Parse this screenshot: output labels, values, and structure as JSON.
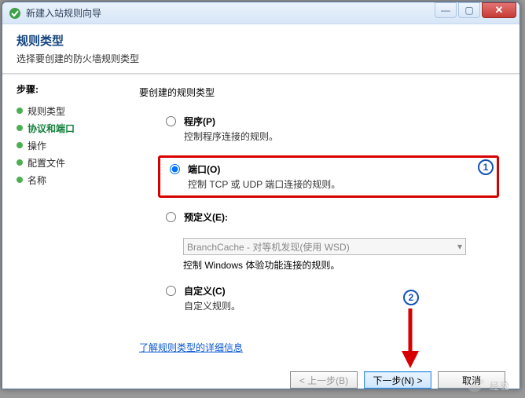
{
  "window": {
    "title": "新建入站规则向导"
  },
  "header": {
    "title": "规则类型",
    "subtitle": "选择要创建的防火墙规则类型"
  },
  "sidebar": {
    "heading": "步骤:",
    "items": [
      {
        "label": "规则类型"
      },
      {
        "label": "协议和端口"
      },
      {
        "label": "操作"
      },
      {
        "label": "配置文件"
      },
      {
        "label": "名称"
      }
    ],
    "activeIndex": 1
  },
  "main": {
    "group_label": "要创建的规则类型",
    "options": {
      "program": {
        "label": "程序(P)",
        "desc": "控制程序连接的规则。"
      },
      "port": {
        "label": "端口(O)",
        "desc": "控制 TCP 或 UDP 端口连接的规则。"
      },
      "predef": {
        "label": "预定义(E):",
        "dropdown": "BranchCache - 对等机发现(使用 WSD)",
        "desc": "控制 Windows 体验功能连接的规则。"
      },
      "custom": {
        "label": "自定义(C)",
        "desc": "自定义规则。"
      }
    },
    "link_more": "了解规则类型的详细信息",
    "buttons": {
      "back": "< 上一步(B)",
      "next": "下一步(N) >",
      "cancel": "取消"
    }
  },
  "annotations": {
    "badge1": "1",
    "badge2": "2"
  },
  "watermark": {
    "text": "经验"
  }
}
